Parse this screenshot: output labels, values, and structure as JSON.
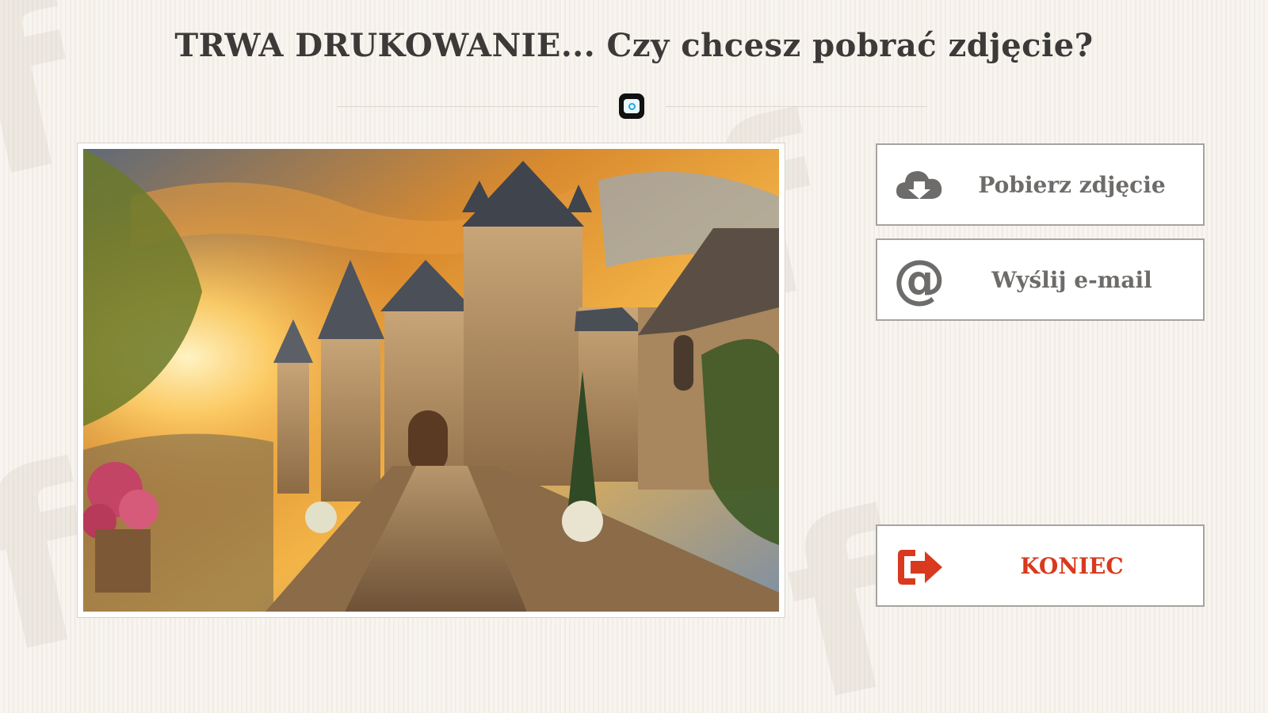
{
  "header": {
    "title": "TRWA DRUKOWANIE... Czy chcesz pobrać zdjęcie?"
  },
  "logo": {
    "icon": "camera-logo-icon"
  },
  "photo": {
    "alt": ""
  },
  "actions": {
    "download": {
      "label": "Pobierz zdjęcie",
      "icon": "cloud-download-icon"
    },
    "email": {
      "label": "Wyślij e-mail",
      "icon": "at-sign-icon"
    },
    "end": {
      "label": "KONIEC",
      "icon": "exit-arrow-icon"
    }
  },
  "colors": {
    "title": "#3c3a38",
    "button_text": "#6e6c6a",
    "button_icon": "#6e6c6a",
    "end_accent": "#d9391e",
    "background": "#f7f4ef"
  }
}
